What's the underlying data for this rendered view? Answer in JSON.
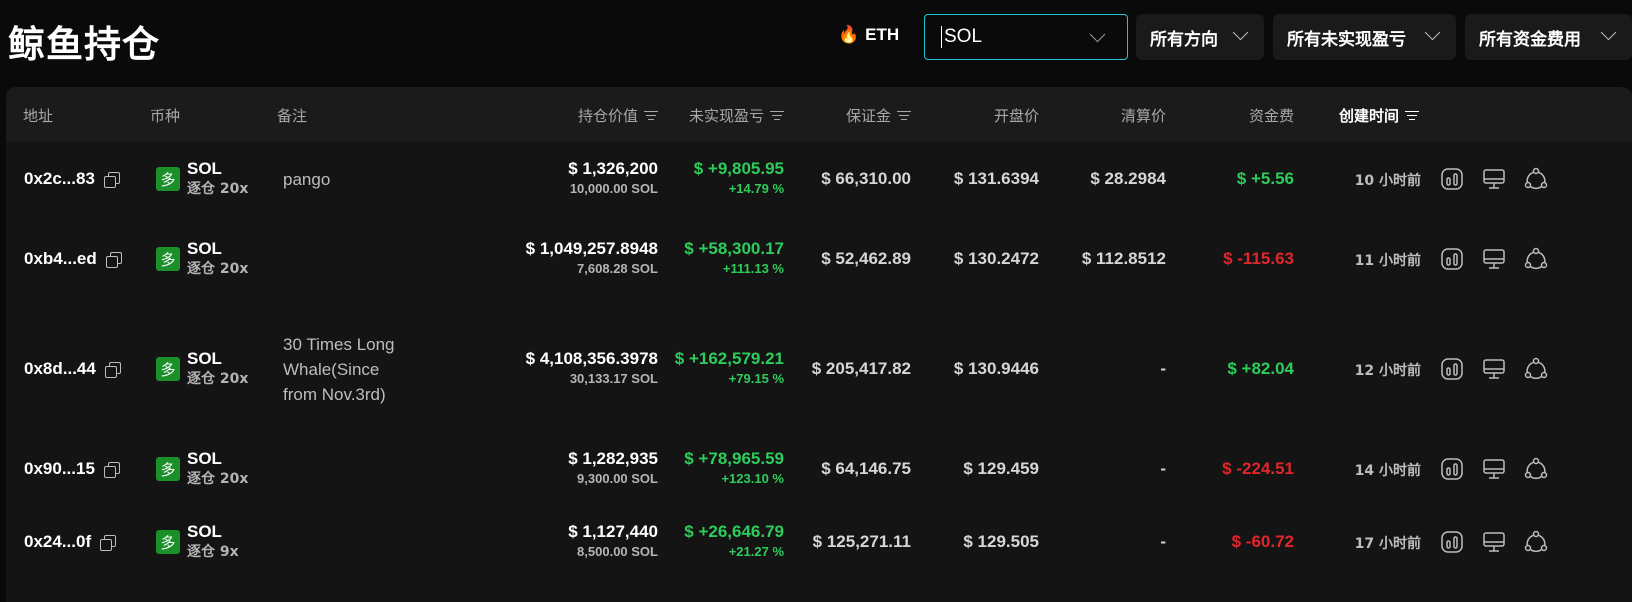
{
  "page": {
    "title": "鲸鱼持仓"
  },
  "filters": {
    "hot_token": "ETH",
    "search_value": "SOL",
    "direction": "所有方向",
    "pnl": "所有未实现盈亏",
    "funding": "所有资金费用"
  },
  "table": {
    "headers": {
      "address": "地址",
      "coin": "币种",
      "note": "备注",
      "position_value": "持仓价值",
      "unrealized_pnl": "未实现盈亏",
      "margin": "保证金",
      "entry_price": "开盘价",
      "liq_price": "清算价",
      "funding": "资金费",
      "created": "创建时间"
    },
    "rows": [
      {
        "address": "0x2c...83",
        "badge": "多",
        "coin": "SOL",
        "margin_mode": "逐仓 20x",
        "note": "pango",
        "position_value": "$ 1,326,200",
        "position_size": "10,000.00 SOL",
        "pnl": "$ +9,805.95",
        "pnl_pct": "+14.79 %",
        "margin": "$ 66,310.00",
        "entry": "$ 131.6394",
        "liq": "$ 28.2984",
        "funding": "$ +5.56",
        "funding_sign": "pos",
        "created": "10 小时前"
      },
      {
        "address": "0xb4...ed",
        "badge": "多",
        "coin": "SOL",
        "margin_mode": "逐仓 20x",
        "note": "",
        "position_value": "$ 1,049,257.8948",
        "position_size": "7,608.28 SOL",
        "pnl": "$ +58,300.17",
        "pnl_pct": "+111.13 %",
        "margin": "$ 52,462.89",
        "entry": "$ 130.2472",
        "liq": "$ 112.8512",
        "funding": "$ -115.63",
        "funding_sign": "neg",
        "created": "11 小时前"
      },
      {
        "address": "0x8d...44",
        "badge": "多",
        "coin": "SOL",
        "margin_mode": "逐仓 20x",
        "note": "30 Times Long Whale(Since from Nov.3rd)",
        "position_value": "$ 4,108,356.3978",
        "position_size": "30,133.17 SOL",
        "pnl": "$ +162,579.21",
        "pnl_pct": "+79.15 %",
        "margin": "$ 205,417.82",
        "entry": "$ 130.9446",
        "liq": "-",
        "funding": "$ +82.04",
        "funding_sign": "pos",
        "created": "12 小时前"
      },
      {
        "address": "0x90...15",
        "badge": "多",
        "coin": "SOL",
        "margin_mode": "逐仓 20x",
        "note": "",
        "position_value": "$ 1,282,935",
        "position_size": "9,300.00 SOL",
        "pnl": "$ +78,965.59",
        "pnl_pct": "+123.10 %",
        "margin": "$ 64,146.75",
        "entry": "$ 129.459",
        "liq": "-",
        "funding": "$ -224.51",
        "funding_sign": "neg",
        "created": "14 小时前"
      },
      {
        "address": "0x24...0f",
        "badge": "多",
        "coin": "SOL",
        "margin_mode": "逐仓 9x",
        "note": "",
        "position_value": "$ 1,127,440",
        "position_size": "8,500.00 SOL",
        "pnl": "$ +26,646.79",
        "pnl_pct": "+21.27 %",
        "margin": "$ 125,271.11",
        "entry": "$ 129.505",
        "liq": "-",
        "funding": "$ -60.72",
        "funding_sign": "neg",
        "created": "17 小时前"
      }
    ]
  },
  "colors": {
    "accent": "#1ec6d6",
    "positive": "#2ecc5a",
    "negative": "#e0262b",
    "long_badge": "#1a8f2a"
  },
  "icons": {
    "row_actions": [
      "chart-icon",
      "monitor-icon",
      "share-icon"
    ]
  }
}
